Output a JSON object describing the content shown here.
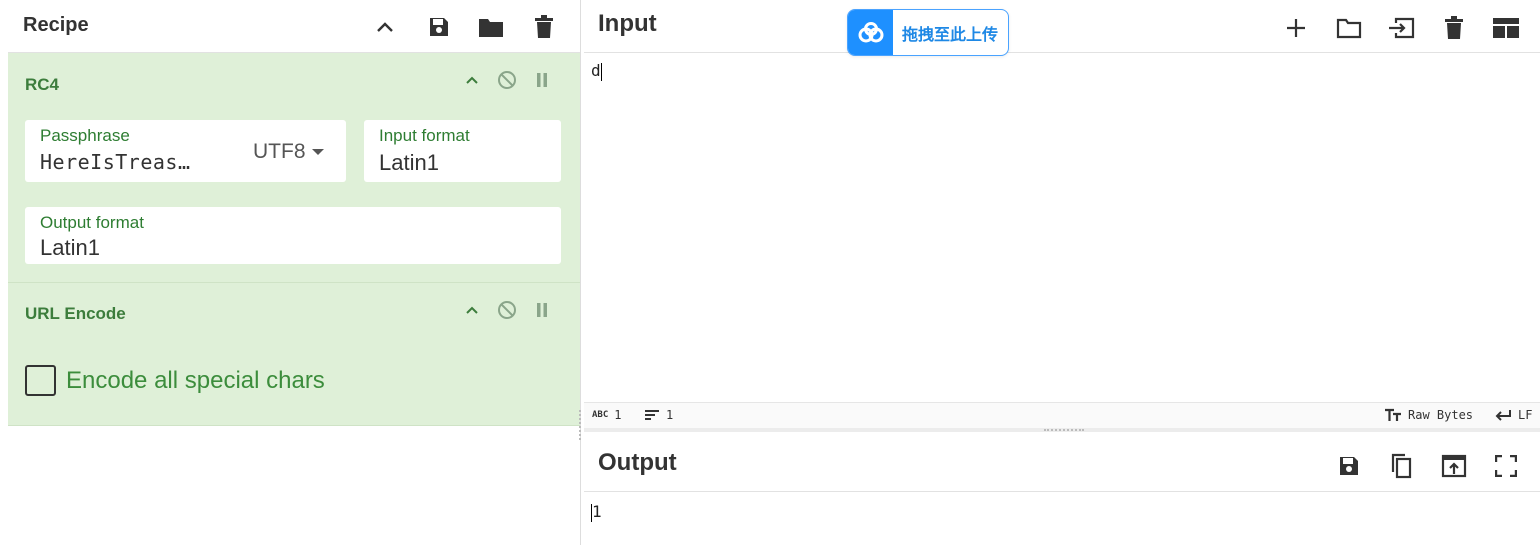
{
  "recipe": {
    "title": "Recipe",
    "operations": [
      {
        "name": "RC4",
        "passphrase_label": "Passphrase",
        "passphrase_value": "HereIsTreas…",
        "passphrase_encoding": "UTF8",
        "input_format_label": "Input format",
        "input_format_value": "Latin1",
        "output_format_label": "Output format",
        "output_format_value": "Latin1"
      },
      {
        "name": "URL Encode",
        "checkbox_label": "Encode all special chars",
        "checkbox_checked": false
      }
    ]
  },
  "input": {
    "title": "Input",
    "value": "d",
    "status": {
      "chars_icon": "abc-icon",
      "chars": "1",
      "lines": "1",
      "encoding": "Raw Bytes",
      "eol": "LF"
    }
  },
  "output": {
    "title": "Output",
    "value": "1"
  },
  "upload": {
    "label": "拖拽至此上传"
  },
  "colors": {
    "op_background": "#dff0d8",
    "op_title": "#3c7d3c",
    "field_label": "#2e7d32",
    "upload_accent": "#1e90ff"
  }
}
